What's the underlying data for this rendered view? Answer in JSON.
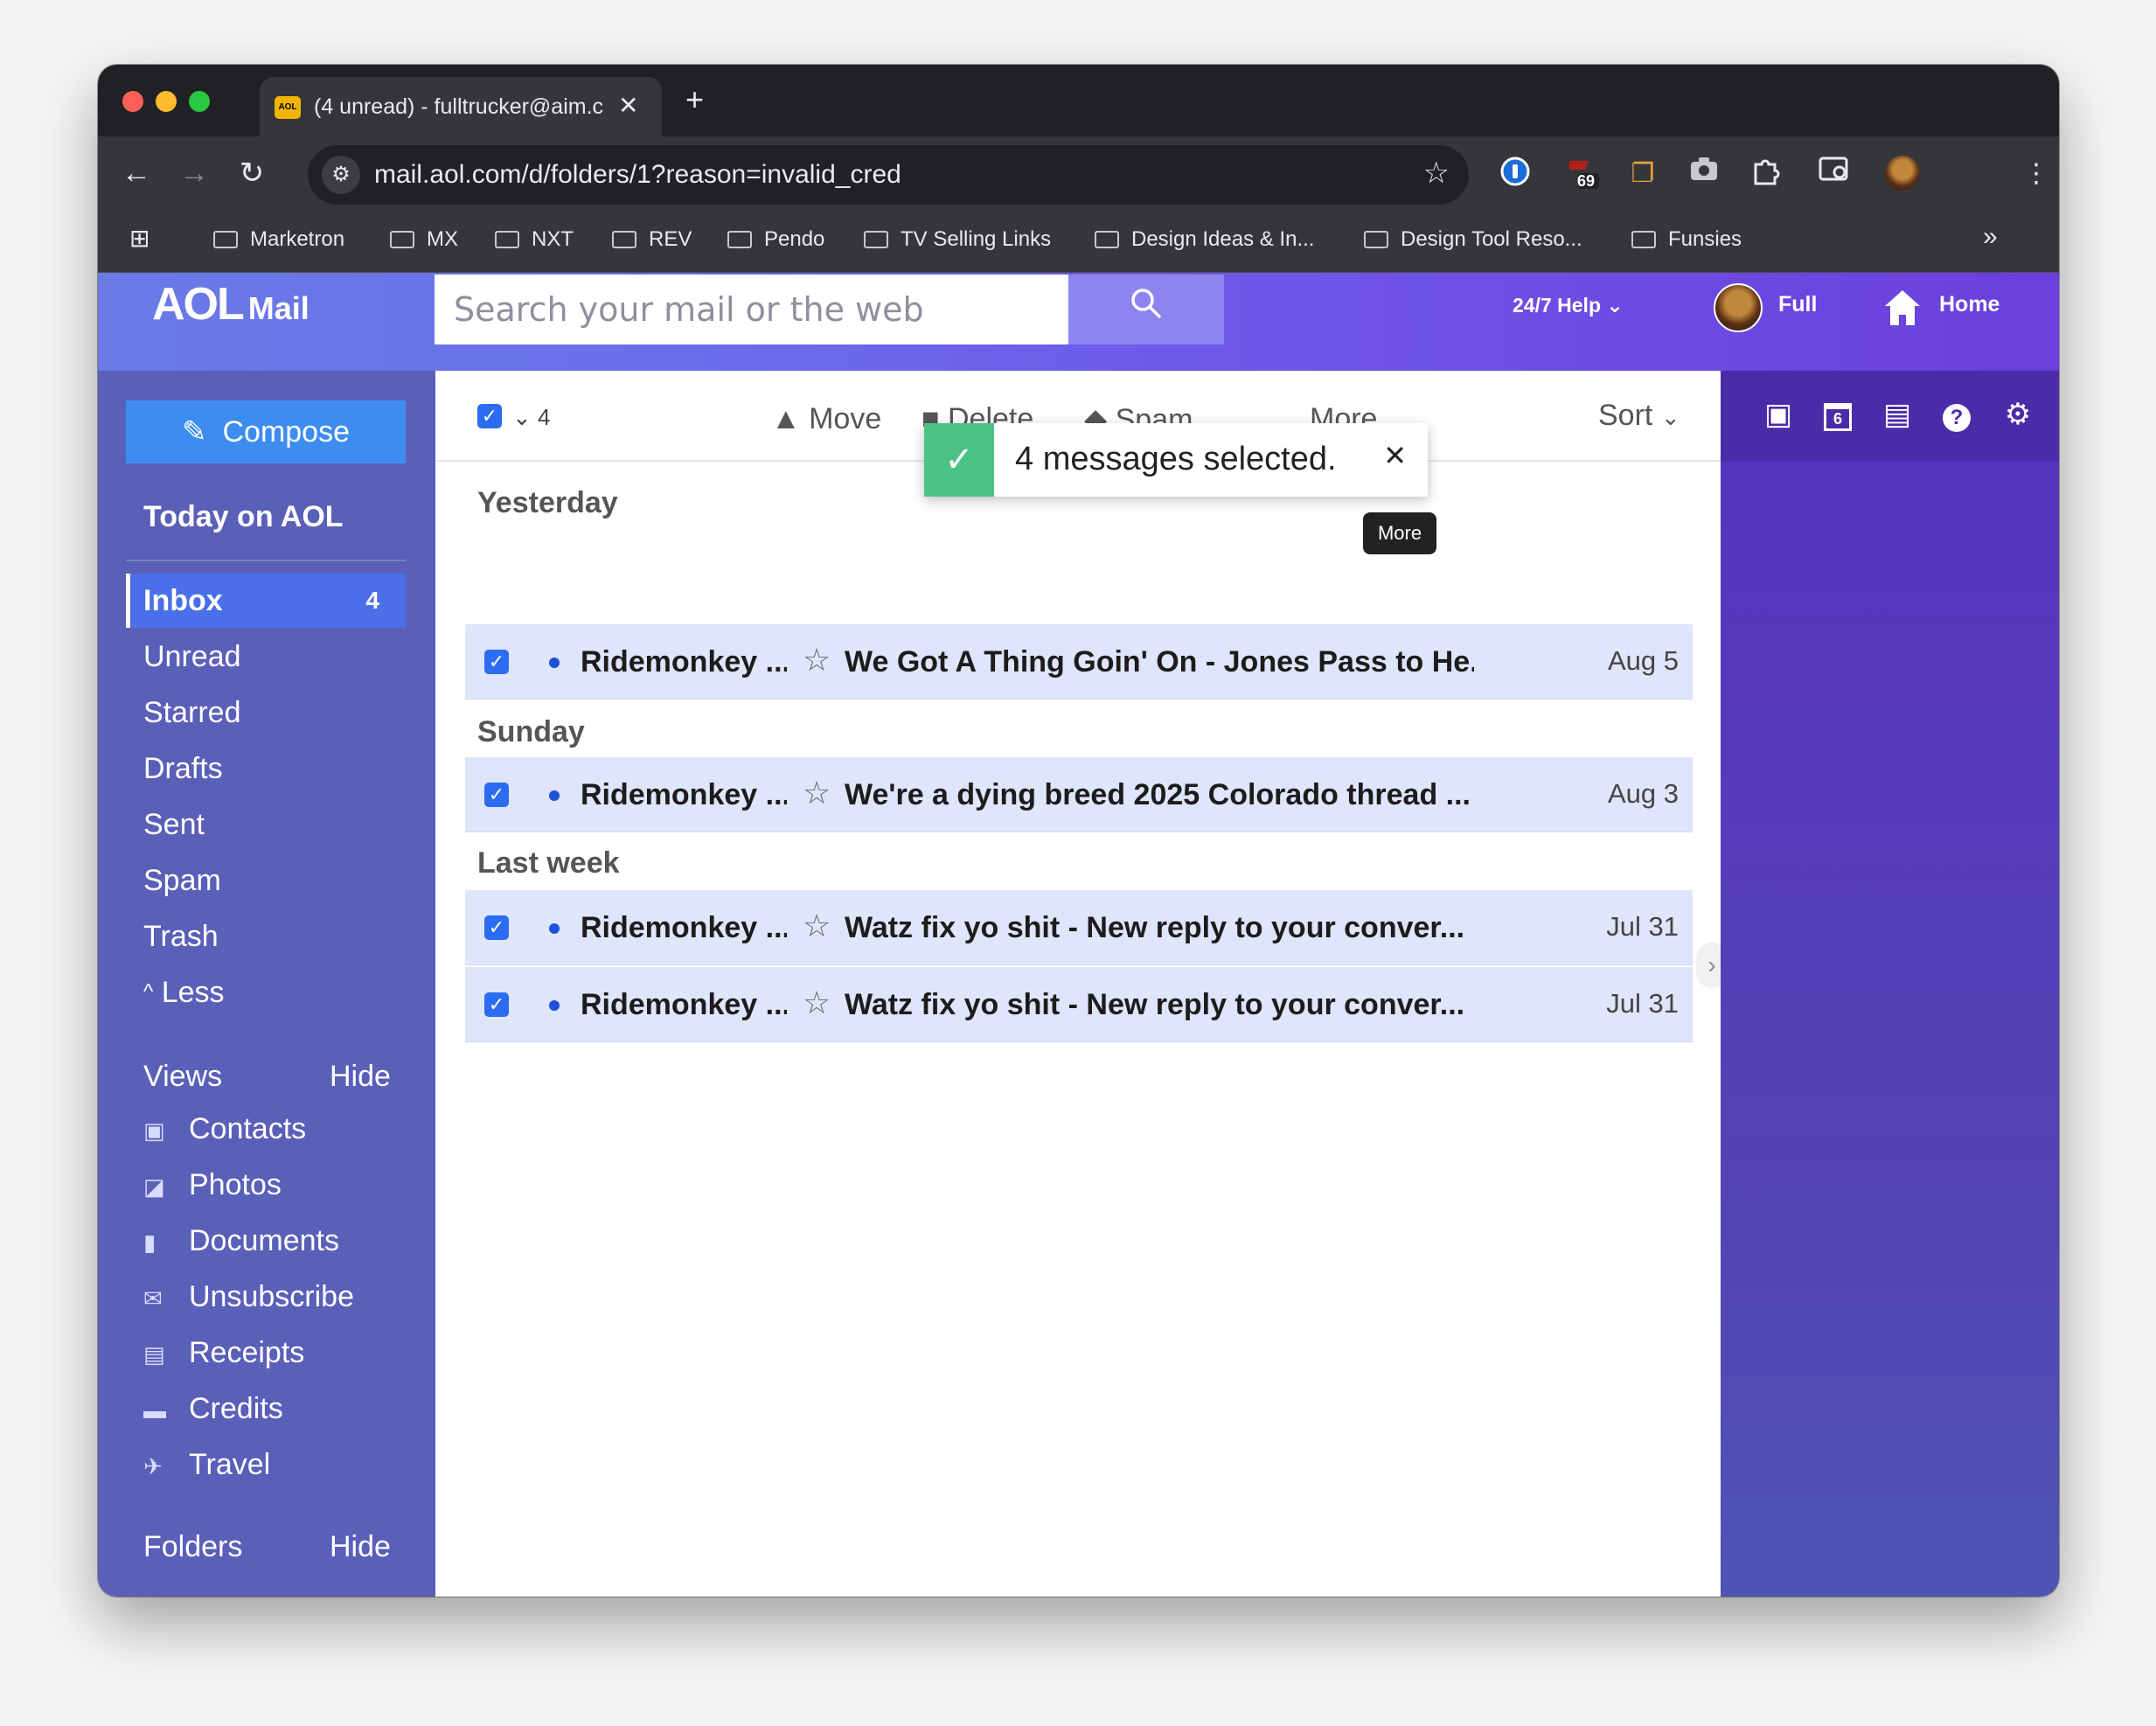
{
  "browser": {
    "tab_title": "(4 unread) - fulltrucker@aim.com",
    "favicon_text": "AOL",
    "url": "mail.aol.com/d/folders/1?reason=invalid_cred",
    "ext_badge": "69",
    "bookmarks": [
      "Marketron",
      "MX",
      "NXT",
      "REV",
      "Pendo",
      "TV Selling Links",
      "Design Ideas & In...",
      "Design Tool Reso...",
      "Funsies"
    ],
    "more_bookmarks": "»"
  },
  "header": {
    "logo_aol": "AOL",
    "logo_mail": "Mail",
    "search_placeholder": "Search your mail or the web",
    "help_label": "24/7 Help",
    "user_label": "Full",
    "home_label": "Home"
  },
  "sidebar": {
    "compose_label": "Compose",
    "today_label": "Today on AOL",
    "folders": [
      {
        "label": "Inbox",
        "count": "4"
      },
      {
        "label": "Unread"
      },
      {
        "label": "Starred"
      },
      {
        "label": "Drafts"
      },
      {
        "label": "Sent"
      },
      {
        "label": "Spam"
      },
      {
        "label": "Trash"
      },
      {
        "label": "Less"
      }
    ],
    "views_label": "Views",
    "views_hide": "Hide",
    "views": [
      {
        "label": "Contacts",
        "icon": "contacts-icon"
      },
      {
        "label": "Photos",
        "icon": "photos-icon"
      },
      {
        "label": "Documents",
        "icon": "documents-icon"
      },
      {
        "label": "Unsubscribe",
        "icon": "unsubscribe-icon"
      },
      {
        "label": "Receipts",
        "icon": "receipts-icon"
      },
      {
        "label": "Credits",
        "icon": "credits-icon"
      },
      {
        "label": "Travel",
        "icon": "travel-icon"
      }
    ],
    "folders_label": "Folders",
    "folders_hide": "Hide"
  },
  "actionbar": {
    "selected_count": "4",
    "move": "Move",
    "delete": "Delete",
    "spam": "Spam",
    "more": "More",
    "sort": "Sort"
  },
  "groups": {
    "g1": "Yesterday",
    "g2": "Sunday",
    "g3": "Last week"
  },
  "messages": [
    {
      "from": "Ridemonkey ...",
      "subject": "We Got A Thing Goin' On - Jones Pass to He...",
      "date": "Aug 5"
    },
    {
      "from": "Ridemonkey ...",
      "subject": "We're a dying breed 2025 Colorado thread ...",
      "date": "Aug 3"
    },
    {
      "from": "Ridemonkey ...",
      "subject": "Watz fix yo shit - New reply to your conver...",
      "date": "Jul 31"
    },
    {
      "from": "Ridemonkey ...",
      "subject": "Watz fix yo shit - New reply to your conver...",
      "date": "Jul 31"
    }
  ],
  "toast": {
    "message": "4 messages selected."
  },
  "tooltip": {
    "text": "More"
  },
  "right_panel": {
    "calendar_day": "6"
  },
  "colors": {
    "accent": "#6a6eeb",
    "sidebar": "#5a5fb8",
    "selected_row": "#dfe5fb",
    "checkbox": "#2b6cf0",
    "toast_check": "#4cc287"
  }
}
